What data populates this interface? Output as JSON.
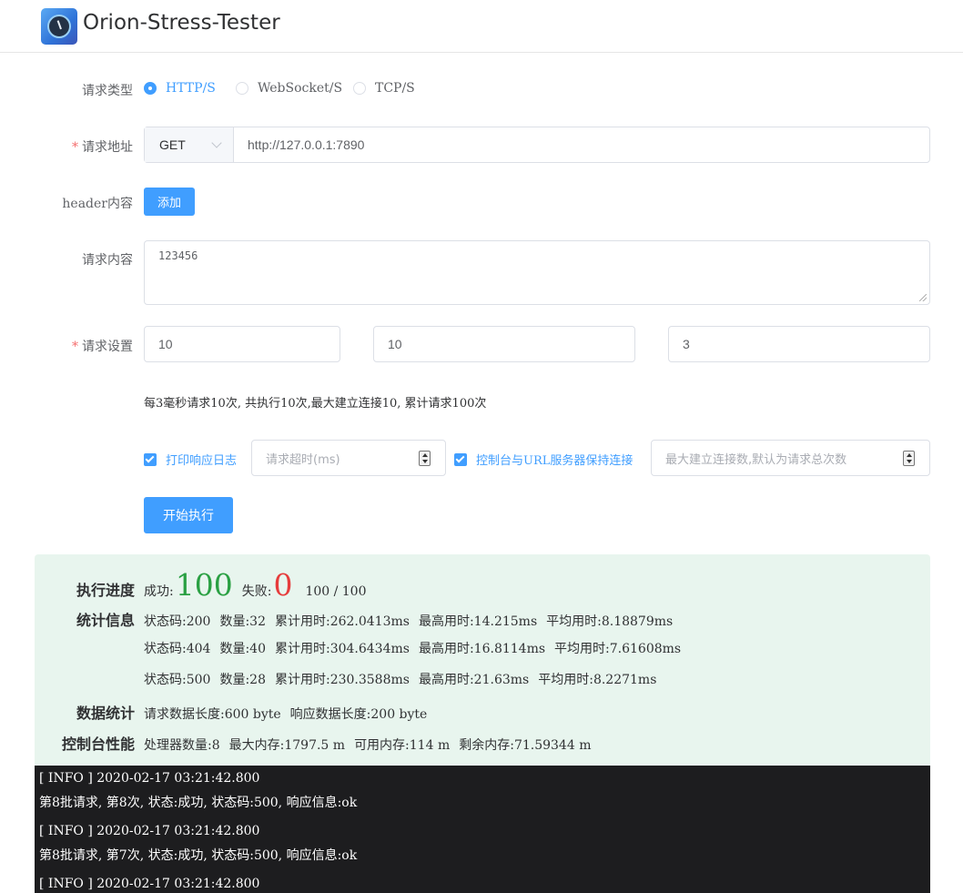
{
  "header": {
    "app_title": "Orion-Stress-Tester",
    "logo_icon": "gauge-logo-icon"
  },
  "form": {
    "request_type_label": "请求类型",
    "request_types": [
      "HTTP/S",
      "WebSocket/S",
      "TCP/S"
    ],
    "selected_request_type": "HTTP/S",
    "url_label": "请求地址",
    "method": "GET",
    "url_value": "http://127.0.0.1:7890",
    "header_label": "header内容",
    "add_button": "添加",
    "body_label": "请求内容",
    "body_value": "123456",
    "settings_label": "请求设置",
    "settings_values": [
      "10",
      "10",
      "3"
    ],
    "settings_summary": "每3毫秒请求10次, 共执行10次,最大建立连接10, 累计请求100次",
    "print_log_label": "打印响应日志",
    "print_log_checked": true,
    "timeout_placeholder": "请求超时(ms)",
    "keepalive_label": "控制台与URL服务器保持连接",
    "keepalive_checked": true,
    "max_conn_placeholder": "最大建立连接数,默认为请求总次数",
    "start_button": "开始执行"
  },
  "stats": {
    "progress_label": "执行进度",
    "success_label": "成功:",
    "success_count": "100",
    "fail_label": "失败:",
    "fail_count": "0",
    "progress_text": "100 / 100",
    "stat_label": "统计信息",
    "status_rows": [
      {
        "code": "状态码:200",
        "count": "数量:32",
        "total": "累计用时:262.0413ms",
        "max": "最高用时:14.215ms",
        "avg": "平均用时:8.18879ms"
      },
      {
        "code": "状态码:404",
        "count": "数量:40",
        "total": "累计用时:304.6434ms",
        "max": "最高用时:16.8114ms",
        "avg": "平均用时:7.61608ms"
      },
      {
        "code": "状态码:500",
        "count": "数量:28",
        "total": "累计用时:230.3588ms",
        "max": "最高用时:21.63ms",
        "avg": "平均用时:8.2271ms"
      }
    ],
    "data_label": "数据统计",
    "req_len": "请求数据长度:600 byte",
    "resp_len": "响应数据长度:200 byte",
    "perf_label": "控制台性能",
    "cpu": "处理器数量:8",
    "max_mem": "最大内存:1797.5 m",
    "avail_mem": "可用内存:114 m",
    "free_mem": "剩余内存:71.59344 m"
  },
  "console": {
    "lines": [
      "[ INFO ] 2020-02-17 03:21:42.800",
      "第8批请求, 第8次, 状态:成功, 状态码:500, 响应信息:ok",
      "[ INFO ] 2020-02-17 03:21:42.800",
      "第8批请求, 第7次, 状态:成功, 状态码:500, 响应信息:ok",
      "[ INFO ] 2020-02-17 03:21:42.800"
    ]
  },
  "colors": {
    "primary": "#409eff",
    "success": "#2aa043",
    "danger": "#e63c3c",
    "stats_bg": "#e8f5ee",
    "console_bg": "#1d1d1f"
  }
}
